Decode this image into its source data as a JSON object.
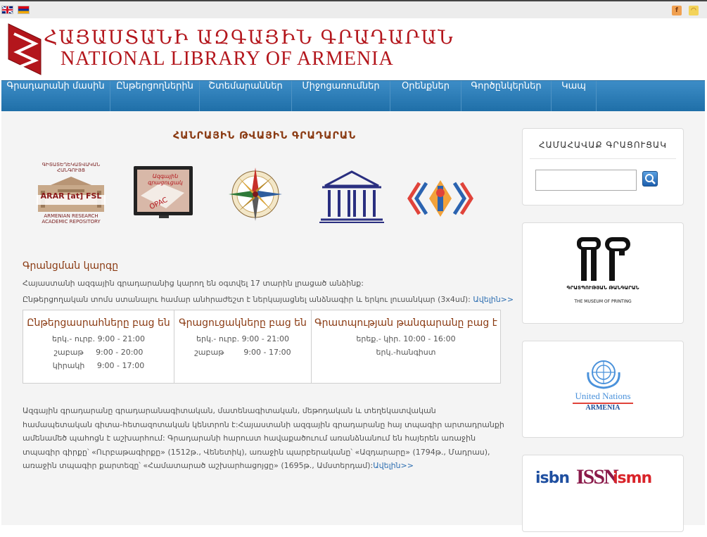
{
  "header": {
    "title_hy": "ՀԱՅԱՍՏԱՆԻ ԱԶԳԱՅԻՆ ԳՐԱԴԱՐԱՆ",
    "title_en": "NATIONAL LIBRARY OF ARMENIA"
  },
  "nav": {
    "items": [
      {
        "label": "Գրադարանի մասին",
        "w": 0
      },
      {
        "label": "Ընթերցողներին"
      },
      {
        "label": "Շտեմարաններ"
      },
      {
        "label": "Միջոցառումներ"
      },
      {
        "label": "Օրենքներ"
      },
      {
        "label": "Գործընկերներ"
      },
      {
        "label": "Կապ"
      }
    ]
  },
  "main": {
    "section_title": "ՀԱՆՐԱՅԻՆ ԹՎԱՅԻՆ ԳՐԱԴԱՐԱՆ",
    "arar": {
      "top": "ԳԻՏԱՏԵՂԵԿԱՏՎԱԿԱՆ ՀԱՆԳՈՒՅՑ",
      "name": "ARAR [at] FSL",
      "bottom1": "ARMENIAN RESEARCH",
      "bottom2": "ACADEMIC REPOSITORY"
    },
    "opac": {
      "top": "Ազգային գրացուցակ",
      "label": "OPAC"
    },
    "registration": {
      "title": "Գրանցման կարգը",
      "line1": "Հայաստանի ազգային գրադարանից  կարող են օգտվել  17 տարին լրացած անձինք:",
      "line2": "Ընթերցողական տոմս ստանալու համար անհրաժեշտ  է ներկայացնել անձնագիր և երկու լուսանկար  (3x4սմ):",
      "more": "Ավելին>>"
    },
    "hours": [
      {
        "title": "Ընթերցասրահները բաց են",
        "rows": [
          [
            "երկ.- ուրբ.",
            "9:00 - 21:00"
          ],
          [
            "շաբաթ",
            "9:00 - 20:00"
          ],
          [
            "կիրակի",
            "9:00 - 17:00"
          ]
        ]
      },
      {
        "title": "Գրացուցակները բաց են",
        "rows": [
          [
            "երկ.- ուրբ.",
            "9:00 - 21:00"
          ],
          [
            "շաբաթ",
            "9:00 - 17:00"
          ]
        ]
      },
      {
        "title": "Գրատպության թանգարանը բաց է",
        "rows": [
          [
            "երեք.- կիր.",
            "10:00 - 16:00"
          ],
          [
            "երկ.-հանգիստ",
            ""
          ]
        ]
      }
    ],
    "about": "Ազգային գրադարանը գրադարանագիտական, մատենագիտական, մեթոդական և տեղեկատվական համապետական գիտա-հետազոտական կենտրոն է:Հայաստանի ազգային գրադարանը հայ տպագիր արտադրանքի ամենամեծ պահոցն է աշխարհում: Գրադարանի հարուստ հավաքածուում առանձնանում են հայերեն առաջին տպագիր գիրքը՝ «Ուրբաթագիրքը» (1512թ., Վենետիկ), առաջին պարբերականը՝ «Ազդարարը» (1794թ., Մադրաս), առաջին տպագիր քարտեզը՝ «Համատարած աշխարհացոյցը» (1695թ., Ամստերդամ):",
    "about_more": "Ավելին>>"
  },
  "sidebar": {
    "search_title": "ՀԱՄԱՀԱՎԱՔ ԳՐԱՑՈՒՑԱԿ",
    "search_value": "",
    "museum_name": "ԳՐԱՏՊՈՒԹՅԱՆ ԹԱՆԳԱՐԱՆ",
    "museum_en": "THE MUSEUM OF PRINTING",
    "un1": "United Nations",
    "un2": "ARMENIA",
    "isbn": "isbn",
    "issn": "ISSN",
    "ismn": "ismn"
  }
}
